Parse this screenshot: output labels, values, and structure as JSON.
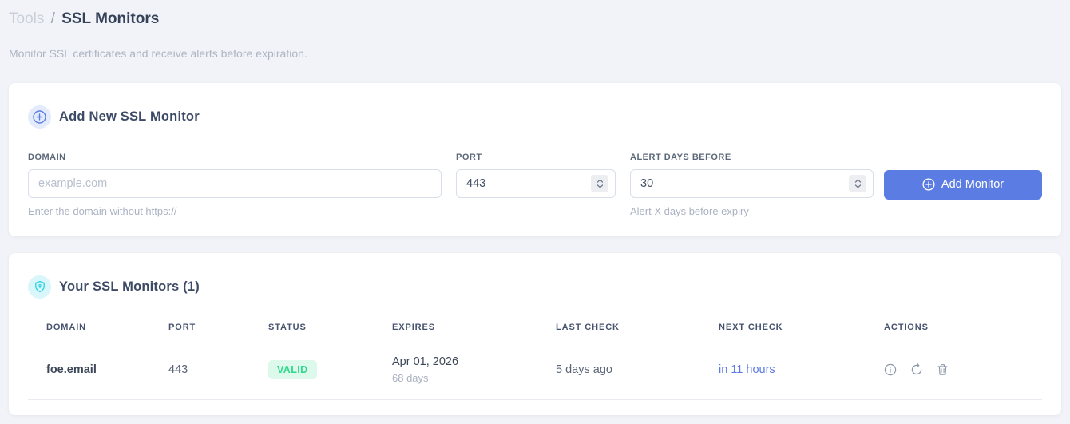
{
  "breadcrumb": {
    "parent": "Tools",
    "separator": "/",
    "current": "SSL Monitors"
  },
  "subtitle": "Monitor SSL certificates and receive alerts before expiration.",
  "add_card": {
    "title": "Add New SSL Monitor",
    "fields": {
      "domain": {
        "label": "DOMAIN",
        "placeholder": "example.com",
        "value": "",
        "help": "Enter the domain without https://"
      },
      "port": {
        "label": "PORT",
        "value": "443"
      },
      "alert_days": {
        "label": "ALERT DAYS BEFORE",
        "value": "30",
        "help": "Alert X days before expiry"
      }
    },
    "submit_label": "Add Monitor"
  },
  "monitors_card": {
    "title": "Your SSL Monitors (1)",
    "count": 1,
    "table": {
      "headers": [
        "DOMAIN",
        "PORT",
        "STATUS",
        "EXPIRES",
        "LAST CHECK",
        "NEXT CHECK",
        "ACTIONS"
      ],
      "rows": [
        {
          "domain": "foe.email",
          "port": "443",
          "status": "VALID",
          "expires_date": "Apr 01, 2026",
          "expires_days": "68 days",
          "last_check": "5 days ago",
          "next_check": "in 11 hours"
        }
      ]
    }
  },
  "icons": {
    "header_add": "plus-circle-icon",
    "header_monitors": "shield-icon",
    "row_actions": [
      "info-icon",
      "refresh-icon",
      "trash-icon"
    ]
  },
  "colors": {
    "accent_blue": "#5b7ce2",
    "accent_cyan": "#29cfe2",
    "status_valid_text": "#2fd98c",
    "status_valid_bg": "#dcf9eb",
    "page_bg": "#f1f3f8"
  }
}
